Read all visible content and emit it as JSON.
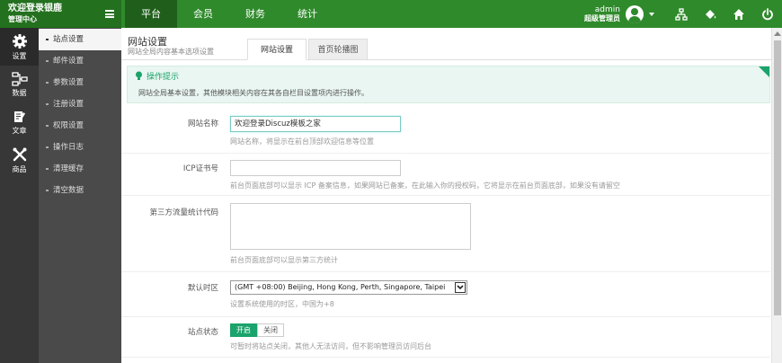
{
  "brand": {
    "title": "欢迎登录银鹿",
    "subtitle": "管理中心"
  },
  "nav": {
    "items": [
      "平台",
      "会员",
      "财务",
      "统计"
    ]
  },
  "user": {
    "name": "admin",
    "role": "超级管理员"
  },
  "iconbar": {
    "items": [
      {
        "label": "设置",
        "icon": "gear-icon"
      },
      {
        "label": "数据",
        "icon": "data-icon"
      },
      {
        "label": "文章",
        "icon": "article-icon"
      },
      {
        "label": "商品",
        "icon": "tools-icon"
      }
    ]
  },
  "submenu": {
    "items": [
      "站点设置",
      "邮件设置",
      "参数设置",
      "注册设置",
      "权限设置",
      "操作日志",
      "清理缓存",
      "清空数据"
    ]
  },
  "page": {
    "title": "网站设置",
    "subtitle": "网站全局内容基本选项设置"
  },
  "tabs": [
    "网站设置",
    "首页轮播图"
  ],
  "tips": {
    "title": "操作提示",
    "text": "网站全局基本设置，其他模块相关内容在其各自栏目设置项内进行操作。"
  },
  "form": {
    "site_name": {
      "label": "网站名称",
      "value": "欢迎登录Discuz模板之家",
      "hint": "网站名称，将显示在前台顶部欢迎信息等位置"
    },
    "icp": {
      "label": "ICP证书号",
      "value": "",
      "hint": "前台页面底部可以显示 ICP 备案信息，如果网站已备案，在此输入你的授权码，它将显示在前台页面底部，如果没有请留空"
    },
    "stats": {
      "label": "第三方流量统计代码",
      "hint": "前台页面底部可以显示第三方统计"
    },
    "timezone": {
      "label": "默认时区",
      "value": "(GMT +08:00) Beijing, Hong Kong, Perth, Singapore, Taipei",
      "hint": "设置系统使用的时区，中国为+8"
    },
    "status": {
      "label": "站点状态",
      "on": "开启",
      "off": "关闭",
      "hint": "可暂时将站点关闭，其他人无法访问，但不影响管理员访问后台"
    }
  },
  "colors": {
    "topbar": "#2f8a2b",
    "accent": "#1aa36b",
    "sidebar": "#373737"
  }
}
